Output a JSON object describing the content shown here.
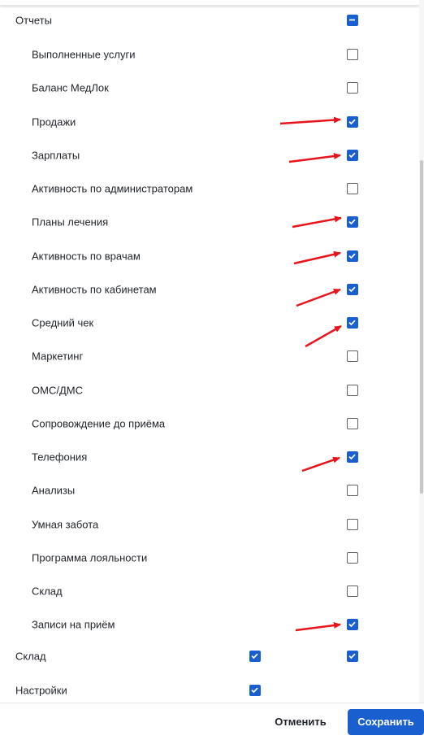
{
  "section_reports": {
    "label": "Отчеты",
    "col2_state": "indeterminate",
    "items": [
      {
        "label": "Выполненные услуги",
        "checked": false
      },
      {
        "label": "Баланс МедЛок",
        "checked": false
      },
      {
        "label": "Продажи",
        "checked": true
      },
      {
        "label": "Зарплаты",
        "checked": true
      },
      {
        "label": "Активность по администраторам",
        "checked": false
      },
      {
        "label": "Планы лечения",
        "checked": true
      },
      {
        "label": "Активность по врачам",
        "checked": true
      },
      {
        "label": "Активность по кабинетам",
        "checked": true
      },
      {
        "label": "Средний чек",
        "checked": true
      },
      {
        "label": "Маркетинг",
        "checked": false
      },
      {
        "label": "ОМС/ДМС",
        "checked": false
      },
      {
        "label": "Сопровождение до приёма",
        "checked": false
      },
      {
        "label": "Телефония",
        "checked": true
      },
      {
        "label": "Анализы",
        "checked": false
      },
      {
        "label": "Умная забота",
        "checked": false
      },
      {
        "label": "Программа лояльности",
        "checked": false
      },
      {
        "label": "Склад",
        "checked": false
      },
      {
        "label": "Записи на приём",
        "checked": true
      }
    ]
  },
  "section_warehouse": {
    "label": "Склад",
    "col1_checked": true,
    "col2_checked": true
  },
  "section_settings": {
    "label": "Настройки",
    "col1_checked": true
  },
  "footer": {
    "cancel_label": "Отменить",
    "save_label": "Сохранить"
  },
  "colors": {
    "accent": "#1a5fd0",
    "arrow": "#e8141b"
  },
  "annotations": {
    "arrow_icon": "red-arrow-icon"
  }
}
